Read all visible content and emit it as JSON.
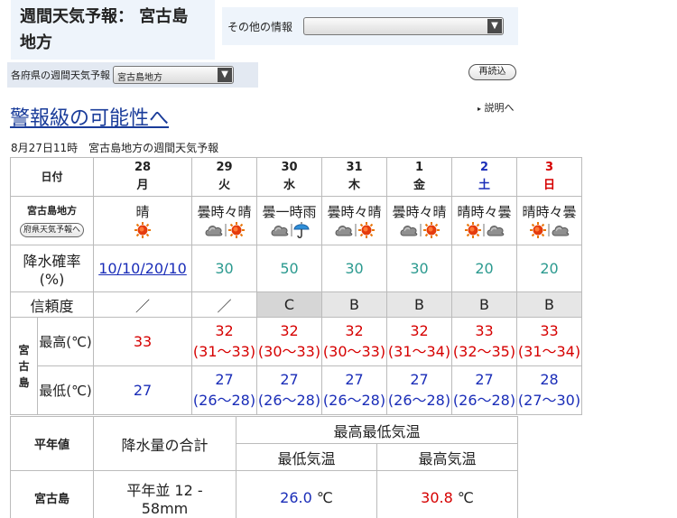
{
  "header": {
    "title_line1": "週間天気予報：",
    "title_line1b": "宮古島",
    "title_line2": "地方"
  },
  "other_info": {
    "label": "その他の情報",
    "value": ""
  },
  "prefecture": {
    "label": "各府県の週間天気予報",
    "selected": "宮古島地方"
  },
  "reload_label": "再読込",
  "warning_link": "警報級の可能性へ",
  "explain_link": "説明へ",
  "issued": "8月27日11時　宮古島地方の週間天気予報",
  "table": {
    "date_label": "日付",
    "region_label": "宮古島地方",
    "region_button": "府県天気予報へ",
    "precip_label": "降水確率",
    "precip_unit": "(%)",
    "reliability_label": "信頼度",
    "city_label": "宮古島",
    "max_label": "最高(℃)",
    "min_label": "最低(℃)",
    "days": [
      {
        "day": "28",
        "wd": "月",
        "weather": "晴",
        "icons": [
          "sun"
        ],
        "pop": "10/10/20/10",
        "rel": "／",
        "max": "33",
        "max_range": "",
        "min": "27",
        "min_range": ""
      },
      {
        "day": "29",
        "wd": "火",
        "weather": "曇時々晴",
        "icons": [
          "cloud",
          "sun"
        ],
        "pop": "30",
        "rel": "／",
        "max": "32",
        "max_range": "(31〜33)",
        "min": "27",
        "min_range": "(26〜28)"
      },
      {
        "day": "30",
        "wd": "水",
        "weather": "曇一時雨",
        "icons": [
          "cloud",
          "umbrella"
        ],
        "pop": "50",
        "rel": "C",
        "max": "32",
        "max_range": "(30〜33)",
        "min": "27",
        "min_range": "(26〜28)"
      },
      {
        "day": "31",
        "wd": "木",
        "weather": "曇時々晴",
        "icons": [
          "cloud",
          "sun"
        ],
        "pop": "30",
        "rel": "B",
        "max": "32",
        "max_range": "(30〜33)",
        "min": "27",
        "min_range": "(26〜28)"
      },
      {
        "day": "1",
        "wd": "金",
        "weather": "曇時々晴",
        "icons": [
          "cloud",
          "sun"
        ],
        "pop": "30",
        "rel": "B",
        "max": "32",
        "max_range": "(31〜34)",
        "min": "27",
        "min_range": "(26〜28)"
      },
      {
        "day": "2",
        "wd": "土",
        "weather": "晴時々曇",
        "icons": [
          "sun",
          "cloud"
        ],
        "pop": "20",
        "rel": "B",
        "max": "33",
        "max_range": "(32〜35)",
        "min": "27",
        "min_range": "(26〜28)"
      },
      {
        "day": "3",
        "wd": "日",
        "weather": "晴時々曇",
        "icons": [
          "sun",
          "cloud"
        ],
        "pop": "20",
        "rel": "B",
        "max": "33",
        "max_range": "(31〜34)",
        "min": "28",
        "min_range": "(27〜30)"
      }
    ]
  },
  "normals": {
    "header_label": "平年値",
    "precip_total_label": "降水量の合計",
    "temp_label": "最高最低気温",
    "min_temp_label": "最低気温",
    "max_temp_label": "最高気温",
    "city": "宮古島",
    "precip_value_line1": "平年並 12 -",
    "precip_value_line2": "58mm",
    "min_value": "26.0",
    "max_value": "30.8",
    "unit": "℃"
  },
  "colors": {
    "panel": "#eef4fb",
    "link": "#1a3c9a",
    "saturday": "#1a2db8",
    "sunday": "#d60000",
    "pop": "#2b9a8f"
  }
}
